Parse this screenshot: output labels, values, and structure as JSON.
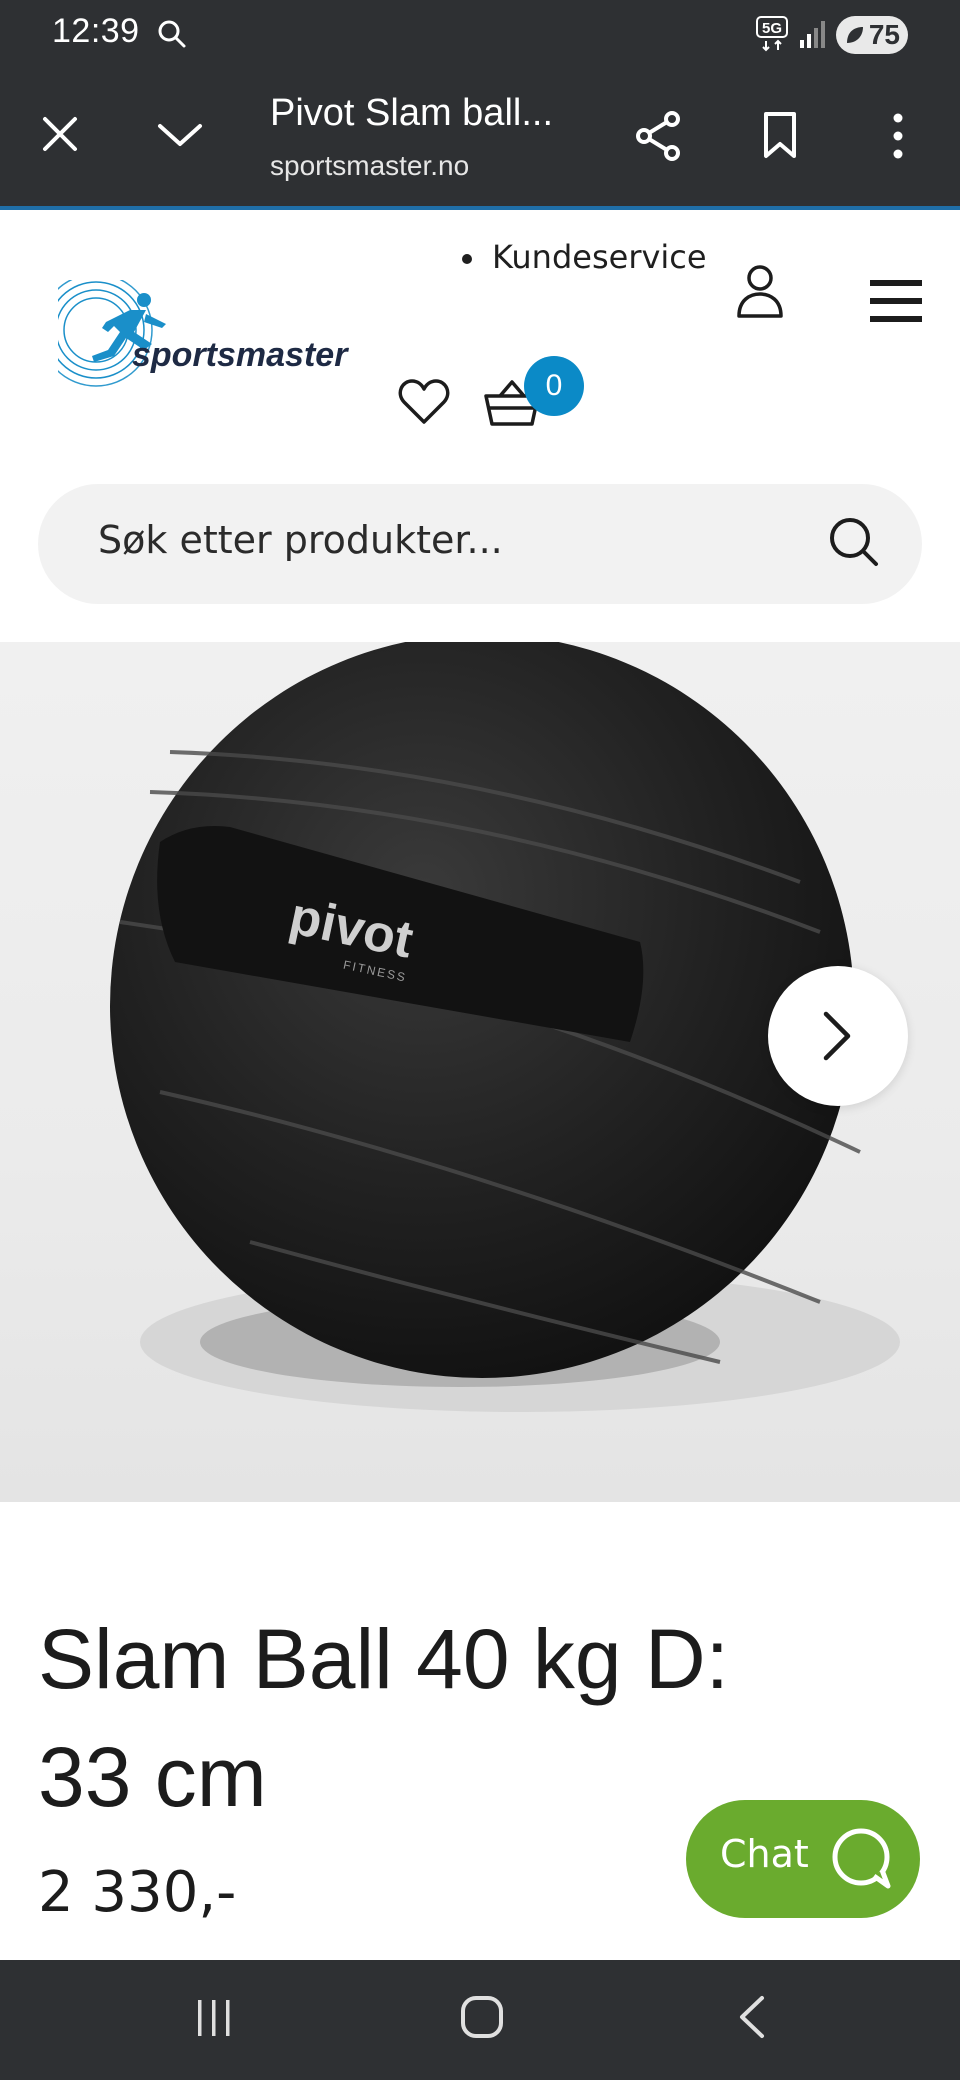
{
  "status_bar": {
    "time": "12:39",
    "battery": "75",
    "network": "5G"
  },
  "browser": {
    "title": "Pivot Slam ball...",
    "url": "sportsmaster.no"
  },
  "header": {
    "kundeservice": "Kundeservice",
    "brand": "sportsmaster",
    "cart_count": "0",
    "search_placeholder": "Søk etter produkter..."
  },
  "product": {
    "title": "Slam Ball 40 kg D: 33 cm",
    "price": "2 330,-",
    "image_logo_text": "pivot",
    "image_logo_sub": "FITNESS"
  },
  "chat": {
    "label": "Chat"
  },
  "colors": {
    "brand_blue": "#0b8ac7",
    "chat_green": "#6aab2e",
    "chrome_dark": "#2e3033"
  }
}
